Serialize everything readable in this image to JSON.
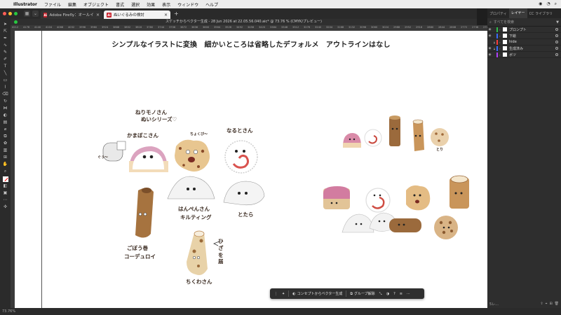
{
  "menubar": {
    "app": "Illustrator",
    "items": [
      "ファイル",
      "編集",
      "オブジェクト",
      "書式",
      "選択",
      "効果",
      "表示",
      "ウィンドウ",
      "ヘルプ"
    ]
  },
  "tabs": [
    {
      "label": "Adobe Firefly：オールインワン",
      "active": false
    },
    {
      "label": "ぬいぐるみの検討",
      "active": true
    }
  ],
  "document": {
    "title": "スケッチからベクター生成 - 28 Jun 2026 at 22.05.56.040.aic* @ 73.76 % (CMYK/プレビュー)"
  },
  "ruler": {
    "ticks": [
      "4212",
      "4176",
      "4140",
      "4104",
      "4068",
      "4032",
      "3996",
      "3960",
      "3924",
      "3888",
      "3852",
      "3816",
      "3780",
      "3744",
      "3708",
      "3672",
      "3636",
      "3600",
      "3564",
      "3528",
      "3492",
      "3456",
      "3420",
      "3384",
      "3348",
      "3312",
      "3276",
      "3240",
      "3204",
      "3168",
      "3132",
      "3096",
      "3060",
      "3024",
      "2988",
      "2952",
      "2916",
      "2880",
      "2844",
      "2808",
      "2772",
      "2736",
      "2700"
    ]
  },
  "canvas": {
    "headline": "シンプルなイラストに変換　細かいところは省略したデフォルメ　アウトラインはなし",
    "labels": {
      "series_line1": "ねりモノさん",
      "series_line2": "ぬいシリーズ♡",
      "kamaboko": "かまぼこさん",
      "naruto": "なるとさん",
      "chokubi": "ちょくび〜",
      "hanpen_line1": "はんぺんさん",
      "hanpen_line2": "キルティング",
      "tatara": "とたら",
      "gobo_line1": "ごぼう巻",
      "gobo_line2": "コーデュロイ",
      "hige": "ひざを届",
      "chikuwa": "ちくわさん",
      "side_small": "ぐぅ〜",
      "tori": "とり"
    }
  },
  "contextbar": {
    "generate": "コンセプトからベクター生成",
    "ungroup": "グループ解除",
    "help": "?"
  },
  "status": {
    "zoom": "73.76%"
  },
  "panel": {
    "tabs": [
      "プロパティ",
      "レイヤー",
      "CC ライブラリ"
    ],
    "search_placeholder": "すべてを検索",
    "layers": [
      {
        "name": "プロンプト",
        "color": "#2fbf4a"
      },
      {
        "name": "下絵",
        "color": "#3a6cff"
      },
      {
        "name": "hide",
        "color": "#ff3b3b"
      },
      {
        "name": "生成済み",
        "color": "#3a6cff"
      },
      {
        "name": "ボツ",
        "color": "#b040ff"
      }
    ],
    "footer": "5レ..."
  }
}
